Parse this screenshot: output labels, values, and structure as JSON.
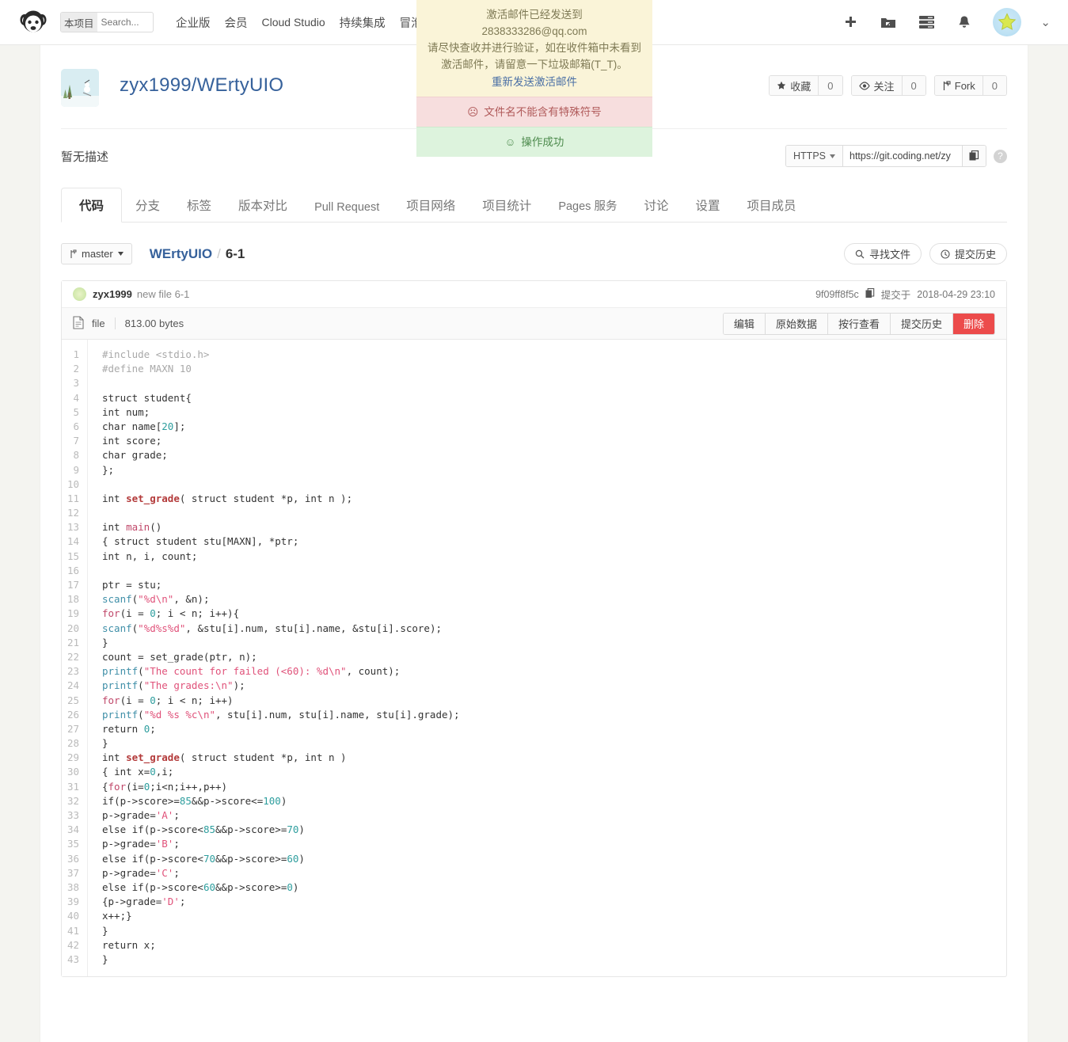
{
  "topnav": {
    "logo_icon": "coding-monkey-logo",
    "search": {
      "scope_label": "本项目",
      "placeholder": "Search...",
      "value": ""
    },
    "links": [
      {
        "label": "企业版",
        "name": "nav-enterprise"
      },
      {
        "label": "会员",
        "name": "nav-member"
      },
      {
        "label": "Cloud Studio",
        "name": "nav-cloud-studio"
      },
      {
        "label": "持续集成",
        "name": "nav-ci"
      },
      {
        "label": "冒泡",
        "name": "nav-bubble"
      }
    ],
    "right_icons": [
      {
        "name": "plus-icon"
      },
      {
        "name": "folder-share-icon"
      },
      {
        "name": "server-list-icon"
      },
      {
        "name": "bell-icon"
      }
    ],
    "avatar_name": "user-avatar",
    "chevron": "⌄"
  },
  "flash": {
    "warn": {
      "line1": "激活邮件已经发送到",
      "email": "2838333286@qq.com",
      "line2": "请尽快查收并进行验证，如在收件箱中未看到",
      "line3": "激活邮件，请留意一下垃圾邮箱(T_T)。",
      "resend": "重新发送激活邮件"
    },
    "error": {
      "face": "☹",
      "text": "文件名不能含有特殊符号"
    },
    "success": {
      "face": "☺",
      "text": "操作成功"
    }
  },
  "repo": {
    "avatar_name": "repo-avatar",
    "full_name": "zyx1999/WErtyUIO",
    "description": "暂无描述",
    "stats": [
      {
        "icon": "star-icon",
        "label": "收藏",
        "count": "0"
      },
      {
        "icon": "eye-icon",
        "label": "关注",
        "count": "0"
      },
      {
        "icon": "fork-icon",
        "label": "Fork",
        "count": "0"
      }
    ],
    "clone": {
      "protocol": "HTTPS",
      "url": "https://git.coding.net/zy",
      "copy_icon": "copy-icon",
      "help_icon": "question-icon"
    }
  },
  "tabs": [
    {
      "label": "代码",
      "active": true
    },
    {
      "label": "分支",
      "active": false
    },
    {
      "label": "标签",
      "active": false
    },
    {
      "label": "版本对比",
      "active": false
    },
    {
      "label": "Pull Request",
      "active": false
    },
    {
      "label": "项目网络",
      "active": false
    },
    {
      "label": "项目统计",
      "active": false
    },
    {
      "label": "Pages 服务",
      "active": false
    },
    {
      "label": "讨论",
      "active": false
    },
    {
      "label": "设置",
      "active": false
    },
    {
      "label": "项目成员",
      "active": false
    }
  ],
  "branchbar": {
    "branch": "master",
    "branch_icon": "branch-icon",
    "crumb_repo": "WErtyUIO",
    "crumb_sep": "/",
    "crumb_current": "6-1",
    "find_file": {
      "label": "寻找文件",
      "icon": "search-icon"
    },
    "commit_history": {
      "label": "提交历史",
      "icon": "clock-icon"
    }
  },
  "commit": {
    "author": "zyx1999",
    "message": "new file 6-1",
    "hash": "9f09ff8f5c",
    "copy_icon": "copy-icon",
    "committed_label": "提交于",
    "committed_at": "2018-04-29 23:10"
  },
  "file": {
    "icon": "file-icon",
    "name": "file",
    "size": "813.00 bytes",
    "actions": [
      {
        "label": "编辑",
        "name": "edit-button",
        "danger": false
      },
      {
        "label": "原始数据",
        "name": "raw-button",
        "danger": false
      },
      {
        "label": "按行查看",
        "name": "blame-button",
        "danger": false
      },
      {
        "label": "提交历史",
        "name": "history-button",
        "danger": false
      },
      {
        "label": "删除",
        "name": "delete-button",
        "danger": true
      }
    ],
    "accent_danger": "#ec4b4b",
    "line_count": 43,
    "lines": [
      [
        {
          "t": "#include <stdio.h>",
          "c": "pp"
        }
      ],
      [
        {
          "t": "#define MAXN 10",
          "c": "pp"
        }
      ],
      [],
      [
        {
          "t": "struct",
          "c": "kw"
        },
        {
          "t": " student{",
          "c": ""
        }
      ],
      [
        {
          "t": "int",
          "c": "kw"
        },
        {
          "t": " num;",
          "c": ""
        }
      ],
      [
        {
          "t": "char",
          "c": "kw"
        },
        {
          "t": " name[",
          "c": ""
        },
        {
          "t": "20",
          "c": "nu"
        },
        {
          "t": "];",
          "c": ""
        }
      ],
      [
        {
          "t": "int",
          "c": "kw"
        },
        {
          "t": " score;",
          "c": ""
        }
      ],
      [
        {
          "t": "char",
          "c": "kw"
        },
        {
          "t": " grade;",
          "c": ""
        }
      ],
      [
        {
          "t": "};",
          "c": ""
        }
      ],
      [],
      [
        {
          "t": "int",
          "c": "kw"
        },
        {
          "t": " ",
          "c": ""
        },
        {
          "t": "set_grade",
          "c": "fn"
        },
        {
          "t": "( ",
          "c": ""
        },
        {
          "t": "struct",
          "c": "kw"
        },
        {
          "t": " student *p, ",
          "c": ""
        },
        {
          "t": "int",
          "c": "kw"
        },
        {
          "t": " n );",
          "c": ""
        }
      ],
      [],
      [
        {
          "t": "int",
          "c": "kw"
        },
        {
          "t": " ",
          "c": ""
        },
        {
          "t": "main",
          "c": "kf"
        },
        {
          "t": "()",
          "c": ""
        }
      ],
      [
        {
          "t": "{ ",
          "c": ""
        },
        {
          "t": "struct",
          "c": "kw"
        },
        {
          "t": " student stu[MAXN], *ptr;",
          "c": ""
        }
      ],
      [
        {
          "t": "int",
          "c": "kw"
        },
        {
          "t": " n, i, count;",
          "c": ""
        }
      ],
      [],
      [
        {
          "t": "ptr = stu;",
          "c": ""
        }
      ],
      [
        {
          "t": "scanf",
          "c": "bi"
        },
        {
          "t": "(",
          "c": ""
        },
        {
          "t": "\"%d\\n\"",
          "c": "st"
        },
        {
          "t": ", &n);",
          "c": ""
        }
      ],
      [
        {
          "t": "for",
          "c": "kf"
        },
        {
          "t": "(i = ",
          "c": ""
        },
        {
          "t": "0",
          "c": "nu"
        },
        {
          "t": "; i < n; i++){",
          "c": ""
        }
      ],
      [
        {
          "t": "scanf",
          "c": "bi"
        },
        {
          "t": "(",
          "c": ""
        },
        {
          "t": "\"%d%s%d\"",
          "c": "st"
        },
        {
          "t": ", &stu[i].num, stu[i].name, &stu[i].score);",
          "c": ""
        }
      ],
      [
        {
          "t": "}",
          "c": ""
        }
      ],
      [
        {
          "t": "count = set_grade(ptr, n);",
          "c": ""
        }
      ],
      [
        {
          "t": "printf",
          "c": "bi"
        },
        {
          "t": "(",
          "c": ""
        },
        {
          "t": "\"The count for failed (<60): %d\\n\"",
          "c": "st"
        },
        {
          "t": ", count);",
          "c": ""
        }
      ],
      [
        {
          "t": "printf",
          "c": "bi"
        },
        {
          "t": "(",
          "c": ""
        },
        {
          "t": "\"The grades:\\n\"",
          "c": "st"
        },
        {
          "t": ");",
          "c": ""
        }
      ],
      [
        {
          "t": "for",
          "c": "kf"
        },
        {
          "t": "(i = ",
          "c": ""
        },
        {
          "t": "0",
          "c": "nu"
        },
        {
          "t": "; i < n; i++)",
          "c": ""
        }
      ],
      [
        {
          "t": "printf",
          "c": "bi"
        },
        {
          "t": "(",
          "c": ""
        },
        {
          "t": "\"%d %s %c\\n\"",
          "c": "st"
        },
        {
          "t": ", stu[i].num, stu[i].name, stu[i].grade);",
          "c": ""
        }
      ],
      [
        {
          "t": "return",
          "c": "kw"
        },
        {
          "t": " ",
          "c": ""
        },
        {
          "t": "0",
          "c": "nu"
        },
        {
          "t": ";",
          "c": ""
        }
      ],
      [
        {
          "t": "}",
          "c": ""
        }
      ],
      [
        {
          "t": "int",
          "c": "kw"
        },
        {
          "t": " ",
          "c": ""
        },
        {
          "t": "set_grade",
          "c": "fn"
        },
        {
          "t": "( ",
          "c": ""
        },
        {
          "t": "struct",
          "c": "kw"
        },
        {
          "t": " student *p, ",
          "c": ""
        },
        {
          "t": "int",
          "c": "kw"
        },
        {
          "t": " n )",
          "c": ""
        }
      ],
      [
        {
          "t": "{ ",
          "c": ""
        },
        {
          "t": "int",
          "c": "kw"
        },
        {
          "t": " x=",
          "c": ""
        },
        {
          "t": "0",
          "c": "nu"
        },
        {
          "t": ",i;",
          "c": ""
        }
      ],
      [
        {
          "t": "{",
          "c": ""
        },
        {
          "t": "for",
          "c": "kf"
        },
        {
          "t": "(i=",
          "c": ""
        },
        {
          "t": "0",
          "c": "nu"
        },
        {
          "t": ";i<n;i++,p++)",
          "c": ""
        }
      ],
      [
        {
          "t": "if",
          "c": "kw"
        },
        {
          "t": "(p->score>=",
          "c": ""
        },
        {
          "t": "85",
          "c": "nu"
        },
        {
          "t": "&&p->score<=",
          "c": ""
        },
        {
          "t": "100",
          "c": "nu"
        },
        {
          "t": ")",
          "c": ""
        }
      ],
      [
        {
          "t": "p->grade=",
          "c": ""
        },
        {
          "t": "'A'",
          "c": "st"
        },
        {
          "t": ";",
          "c": ""
        }
      ],
      [
        {
          "t": "else",
          "c": "kw"
        },
        {
          "t": " ",
          "c": ""
        },
        {
          "t": "if",
          "c": "kw"
        },
        {
          "t": "(p->score<",
          "c": ""
        },
        {
          "t": "85",
          "c": "nu"
        },
        {
          "t": "&&p->score>=",
          "c": ""
        },
        {
          "t": "70",
          "c": "nu"
        },
        {
          "t": ")",
          "c": ""
        }
      ],
      [
        {
          "t": "p->grade=",
          "c": ""
        },
        {
          "t": "'B'",
          "c": "st"
        },
        {
          "t": ";",
          "c": ""
        }
      ],
      [
        {
          "t": "else",
          "c": "kw"
        },
        {
          "t": " ",
          "c": ""
        },
        {
          "t": "if",
          "c": "kw"
        },
        {
          "t": "(p->score<",
          "c": ""
        },
        {
          "t": "70",
          "c": "nu"
        },
        {
          "t": "&&p->score>=",
          "c": ""
        },
        {
          "t": "60",
          "c": "nu"
        },
        {
          "t": ")",
          "c": ""
        }
      ],
      [
        {
          "t": "p->grade=",
          "c": ""
        },
        {
          "t": "'C'",
          "c": "st"
        },
        {
          "t": ";",
          "c": ""
        }
      ],
      [
        {
          "t": "else",
          "c": "kw"
        },
        {
          "t": " ",
          "c": ""
        },
        {
          "t": "if",
          "c": "kw"
        },
        {
          "t": "(p->score<",
          "c": ""
        },
        {
          "t": "60",
          "c": "nu"
        },
        {
          "t": "&&p->score>=",
          "c": ""
        },
        {
          "t": "0",
          "c": "nu"
        },
        {
          "t": ")",
          "c": ""
        }
      ],
      [
        {
          "t": "{p->grade=",
          "c": ""
        },
        {
          "t": "'D'",
          "c": "st"
        },
        {
          "t": ";",
          "c": ""
        }
      ],
      [
        {
          "t": "x++;}",
          "c": ""
        }
      ],
      [
        {
          "t": "}",
          "c": ""
        }
      ],
      [
        {
          "t": "return",
          "c": "kw"
        },
        {
          "t": " x;",
          "c": ""
        }
      ],
      [
        {
          "t": "}",
          "c": ""
        }
      ]
    ]
  }
}
